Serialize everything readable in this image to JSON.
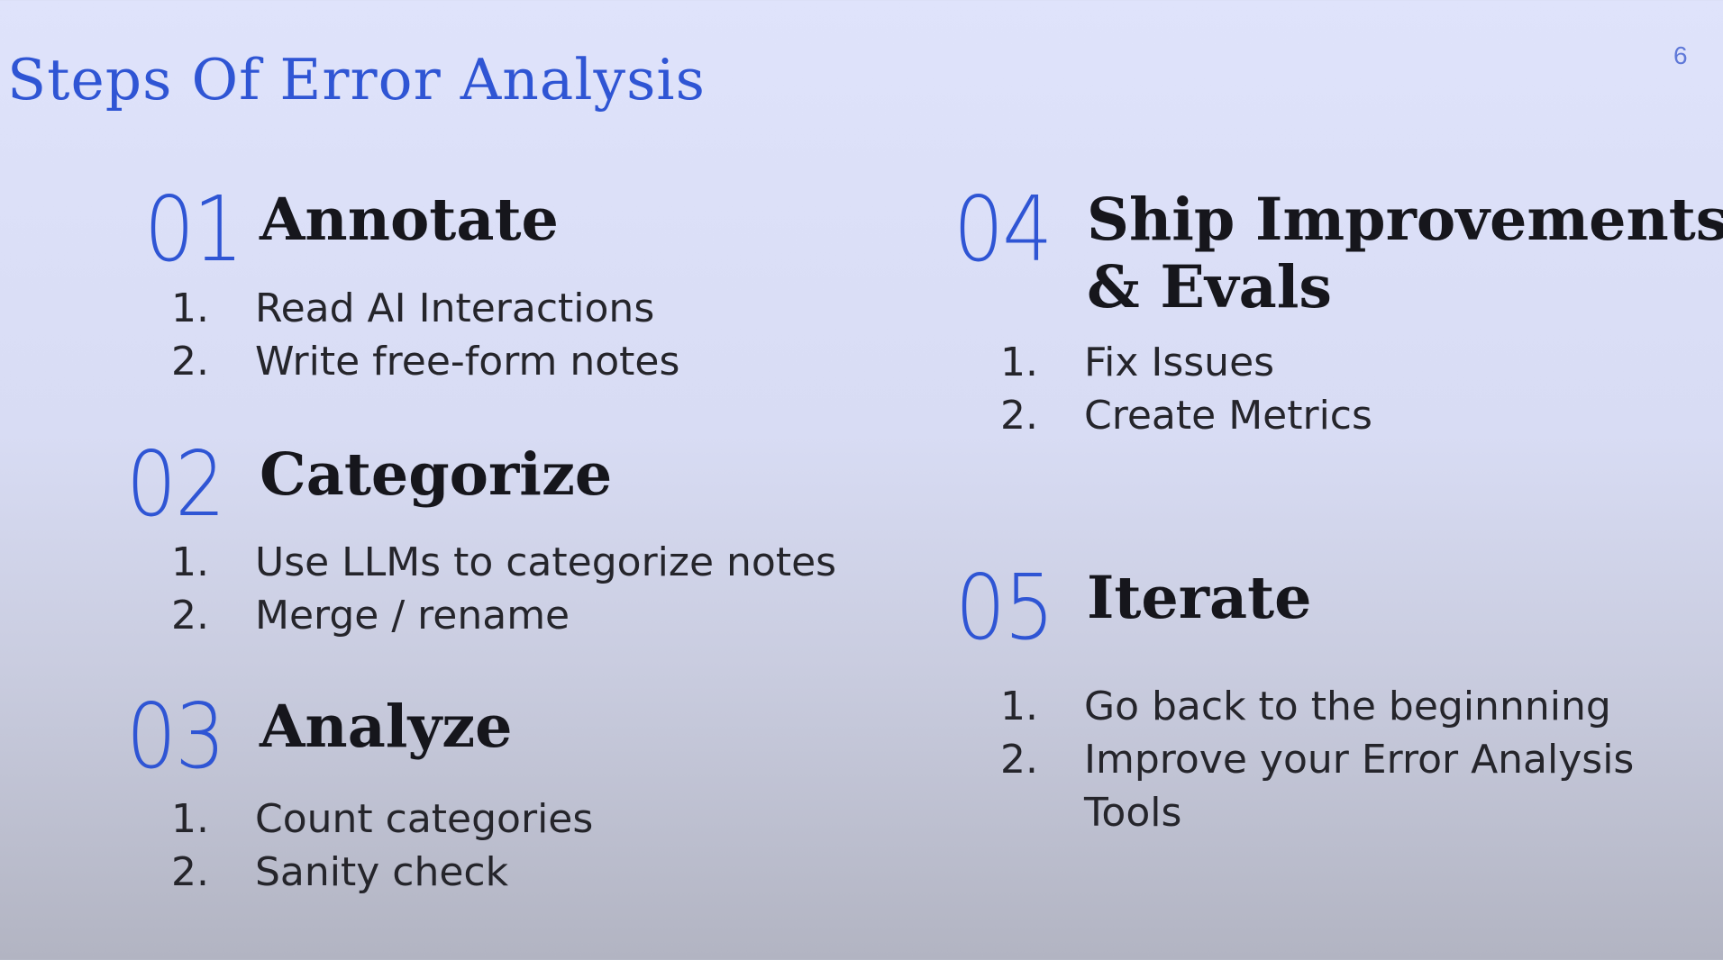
{
  "slide": {
    "title": "Steps Of Error Analysis",
    "page_number": "6"
  },
  "steps": [
    {
      "number": "01",
      "heading": "Annotate",
      "items": [
        {
          "marker": "1.",
          "text": "Read AI Interactions"
        },
        {
          "marker": "2.",
          "text": "Write free-form notes"
        }
      ]
    },
    {
      "number": "02",
      "heading": "Categorize",
      "items": [
        {
          "marker": "1.",
          "text": "Use LLMs to categorize notes"
        },
        {
          "marker": "2.",
          "text": "Merge / rename"
        }
      ]
    },
    {
      "number": "03",
      "heading": "Analyze",
      "items": [
        {
          "marker": "1.",
          "text": "Count categories"
        },
        {
          "marker": "2.",
          "text": "Sanity check"
        }
      ]
    },
    {
      "number": "04",
      "heading_line1": "Ship Improvements",
      "heading_line2": "& Evals",
      "items": [
        {
          "marker": "1.",
          "text": "Fix Issues"
        },
        {
          "marker": "2.",
          "text": "Create Metrics"
        }
      ]
    },
    {
      "number": "05",
      "heading": "Iterate",
      "items": [
        {
          "marker": "1.",
          "text": "Go back to the beginnning"
        },
        {
          "marker": "2.",
          "text": "Improve your Error Analysis Tools"
        }
      ]
    }
  ]
}
